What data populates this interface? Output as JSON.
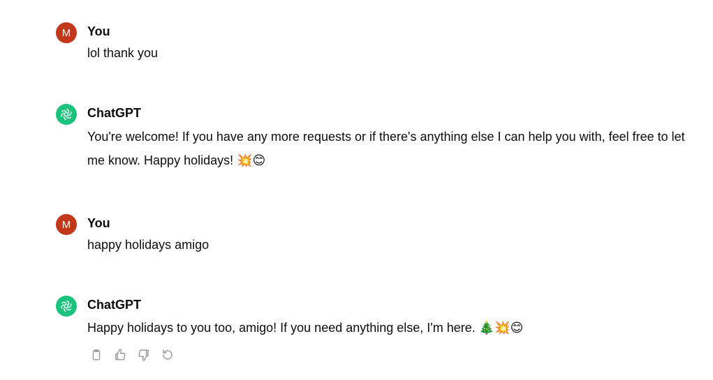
{
  "conversation": {
    "messages": [
      {
        "role": "user",
        "author": "You",
        "avatar_initial": "M",
        "text": "lol thank you"
      },
      {
        "role": "assistant",
        "author": "ChatGPT",
        "avatar_icon": "openai-logo-icon",
        "text": "You're welcome! If you have any more requests or if there's anything else I can help you with, feel free to let me know. Happy holidays! 💥😊"
      },
      {
        "role": "user",
        "author": "You",
        "avatar_initial": "M",
        "text": "happy holidays amigo"
      },
      {
        "role": "assistant",
        "author": "ChatGPT",
        "avatar_icon": "openai-logo-icon",
        "text": "Happy holidays to you too, amigo! If you need anything else, I'm here. 🎄💥😊"
      }
    ],
    "actions": [
      {
        "name": "copy",
        "icon": "clipboard-icon"
      },
      {
        "name": "thumbs-up",
        "icon": "thumbs-up-icon"
      },
      {
        "name": "thumbs-down",
        "icon": "thumbs-down-icon"
      },
      {
        "name": "regenerate",
        "icon": "regenerate-icon"
      }
    ]
  },
  "colors": {
    "user_avatar": "#c1381a",
    "assistant_avatar": "#19c37d",
    "action_icon": "#9b9b9b",
    "text": "#0d0d0d"
  }
}
